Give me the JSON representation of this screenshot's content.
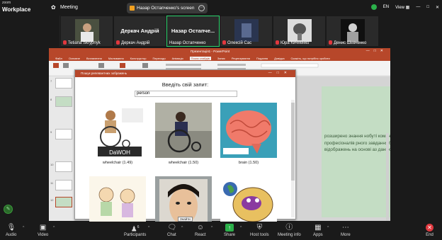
{
  "zoom": {
    "logo_top": "zoom",
    "logo_main": "Workplace",
    "meeting_label": "Meeting",
    "screen_share_label": "Назар Остапченко's screen",
    "language": "EN",
    "view_label": "View"
  },
  "participants": [
    {
      "name": "Tetiana Skrypnyk",
      "big": ""
    },
    {
      "name": "Деркач Андрій",
      "big": "Деркач Андрій"
    },
    {
      "name": "Назар Остапченко",
      "big": "Назар Остапче..."
    },
    {
      "name": "Олексій Сас",
      "big": ""
    },
    {
      "name": "Юра Кичненко",
      "big": ""
    },
    {
      "name": "Денис Шевченко",
      "big": ""
    }
  ],
  "powerpoint": {
    "title": "Презентація1 - PowerPoint",
    "tabs": [
      "Файл",
      "Основне",
      "Вставлення",
      "Малювання",
      "Конструктор",
      "Переходи",
      "Анімація",
      "Показ слайдів",
      "Запис",
      "Рецензування",
      "Подання",
      "Довідка",
      "Скажіть, що потрібно зробити"
    ],
    "selected_tab": "Показ слайдів",
    "slide_text": "розширено знання нобуті команді професіоналів рного завдання було відображень на основі аз даних.",
    "slide_number": "12",
    "thumb_numbers": [
      "7",
      "8",
      "9",
      "10",
      "11",
      "12"
    ]
  },
  "dialog": {
    "title": "Пошук релевантних зображень",
    "prompt": "Введіть свій запит:",
    "query": "person",
    "results": [
      {
        "caption": "wheelchair (1.49)"
      },
      {
        "caption": "wheelchair (1.50)"
      },
      {
        "caption": "brain (1.50)"
      },
      {
        "caption": ""
      },
      {
        "caption": ""
      },
      {
        "caption": ""
      }
    ],
    "tooltip": "Знайти"
  },
  "controls": [
    {
      "label": "Audio",
      "icon": "mic-icon"
    },
    {
      "label": "Video",
      "icon": "video-off-icon"
    },
    {
      "label": "Participants",
      "icon": "participants-icon",
      "count": "6"
    },
    {
      "label": "Chat",
      "icon": "chat-icon"
    },
    {
      "label": "React",
      "icon": "react-icon"
    },
    {
      "label": "Share",
      "icon": "share-icon"
    },
    {
      "label": "Host tools",
      "icon": "host-tools-icon"
    },
    {
      "label": "Meeting info",
      "icon": "info-icon"
    },
    {
      "label": "Apps",
      "icon": "apps-icon"
    },
    {
      "label": "More",
      "icon": "more-icon"
    },
    {
      "label": "End",
      "icon": "end-icon"
    }
  ]
}
